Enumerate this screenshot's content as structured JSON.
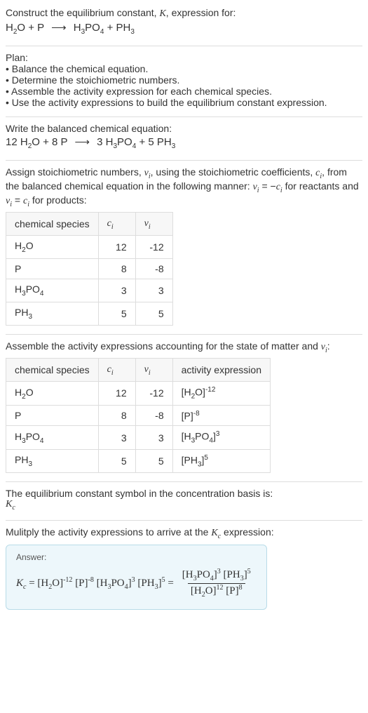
{
  "intro": {
    "line1": "Construct the equilibrium constant, K, expression for:",
    "unbalanced": {
      "lhs1": "H",
      "lhs1s": "2",
      "lhs1b": "O",
      "plus": " + ",
      "lhs2": "P",
      "rhs1": "H",
      "rhs1s": "3",
      "rhs1b": "PO",
      "rhs1s2": "4",
      "rhs2": "PH",
      "rhs2s": "3"
    }
  },
  "plan": {
    "title": "Plan:",
    "b1": "• Balance the chemical equation.",
    "b2": "• Determine the stoichiometric numbers.",
    "b3": "• Assemble the activity expression for each chemical species.",
    "b4": "• Use the activity expressions to build the equilibrium constant expression."
  },
  "balanced": {
    "title": "Write the balanced chemical equation:",
    "c1": "12",
    "c2": "8",
    "c3": "3",
    "c4": "5"
  },
  "stoich": {
    "title_a": "Assign stoichiometric numbers, ",
    "title_b": ", using the stoichiometric coefficients, ",
    "title_c": ", from the balanced chemical equation in the following manner: ",
    "title_d": " for reactants and ",
    "title_e": " for products:",
    "head_species": "chemical species",
    "head_c": "c",
    "head_v": "ν",
    "rows": {
      "r0": {
        "c": "12",
        "v": "-12"
      },
      "r1": {
        "c": "8",
        "v": "-8"
      },
      "r2": {
        "c": "3",
        "v": "3"
      },
      "r3": {
        "c": "5",
        "v": "5"
      }
    }
  },
  "activity": {
    "title_a": "Assemble the activity expressions accounting for the state of matter and ",
    "title_b": ":",
    "head_species": "chemical species",
    "head_c": "c",
    "head_v": "ν",
    "head_act": "activity expression",
    "rows": {
      "r0": {
        "c": "12",
        "v": "-12",
        "exp": "-12"
      },
      "r1": {
        "c": "8",
        "v": "-8",
        "exp": "-8"
      },
      "r2": {
        "c": "3",
        "v": "3",
        "exp": "3"
      },
      "r3": {
        "c": "5",
        "v": "5",
        "exp": "5"
      }
    }
  },
  "kc_symbol": {
    "line": "The equilibrium constant symbol in the concentration basis is:"
  },
  "mult": {
    "line": "Mulitply the activity expressions to arrive at the ",
    "line2": " expression:"
  },
  "answer": {
    "label": "Answer:",
    "exp_h2o": "-12",
    "exp_p": "-8",
    "exp_h3po4": "3",
    "exp_ph3": "5",
    "frac_num_h3po4": "3",
    "frac_num_ph3": "5",
    "frac_den_h2o": "12",
    "frac_den_p": "8"
  },
  "chart_data": {
    "type": "table",
    "tables": [
      {
        "title": "Stoichiometric numbers",
        "columns": [
          "chemical species",
          "c_i",
          "ν_i"
        ],
        "rows": [
          [
            "H2O",
            12,
            -12
          ],
          [
            "P",
            8,
            -8
          ],
          [
            "H3PO4",
            3,
            3
          ],
          [
            "PH3",
            5,
            5
          ]
        ]
      },
      {
        "title": "Activity expressions",
        "columns": [
          "chemical species",
          "c_i",
          "ν_i",
          "activity expression"
        ],
        "rows": [
          [
            "H2O",
            12,
            -12,
            "[H2O]^-12"
          ],
          [
            "P",
            8,
            -8,
            "[P]^-8"
          ],
          [
            "H3PO4",
            3,
            3,
            "[H3PO4]^3"
          ],
          [
            "PH3",
            5,
            5,
            "[PH3]^5"
          ]
        ]
      }
    ],
    "balanced_equation": "12 H2O + 8 P ⟶ 3 H3PO4 + 5 PH3",
    "Kc": "[H3PO4]^3 [PH3]^5 / ([H2O]^12 [P]^8)"
  }
}
